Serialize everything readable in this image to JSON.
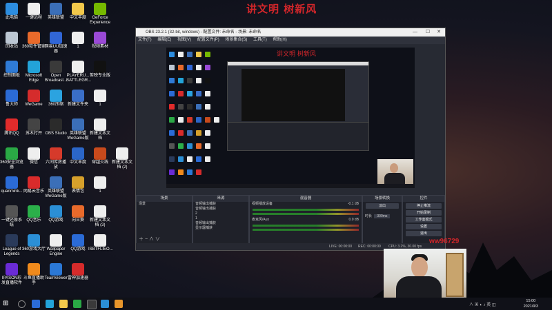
{
  "desktop": {
    "banner": "讲文明 树新风",
    "icons": [
      {
        "label": "此电脑",
        "col": 0,
        "row": 0,
        "color": "#2c8de0"
      },
      {
        "label": "一键远程",
        "col": 1,
        "row": 0,
        "color": "#eeeeee"
      },
      {
        "label": "英雄联盟",
        "col": 2,
        "row": 0,
        "color": "#3b6fb8"
      },
      {
        "label": "中文丰度",
        "col": 3,
        "row": 0,
        "color": "#f2c84b"
      },
      {
        "label": "GeForce Experience",
        "col": 4,
        "row": 0,
        "color": "#76b900"
      },
      {
        "label": "回收站",
        "col": 0,
        "row": 1,
        "color": "#bcc7d3"
      },
      {
        "label": "360软件管家",
        "col": 1,
        "row": 1,
        "color": "#e86a2b"
      },
      {
        "label": "网易UU加速器",
        "col": 2,
        "row": 1,
        "color": "#3166d6"
      },
      {
        "label": "1",
        "col": 3,
        "row": 1,
        "color": "#eeeeee"
      },
      {
        "label": "视频素材",
        "col": 4,
        "row": 1,
        "color": "#9a4ad6"
      },
      {
        "label": "控制面板",
        "col": 0,
        "row": 2,
        "color": "#2f7bd6"
      },
      {
        "label": "Microsoft Edge",
        "col": 1,
        "row": 2,
        "color": "#23a3d8"
      },
      {
        "label": "Open Broadcast...",
        "col": 2,
        "row": 2,
        "color": "#3a3a3a"
      },
      {
        "label": "PLAYERU... BATTLEGR...",
        "col": 3,
        "row": 2,
        "color": "#eeeeee"
      },
      {
        "label": "剪映专业版",
        "col": 4,
        "row": 2,
        "color": "#111111"
      },
      {
        "label": "鲁大师",
        "col": 0,
        "row": 3,
        "color": "#2b6bd6"
      },
      {
        "label": "WeGame",
        "col": 1,
        "row": 3,
        "color": "#d52c2c"
      },
      {
        "label": "360压缩",
        "col": 2,
        "row": 3,
        "color": "#2ba3e0"
      },
      {
        "label": "新建文件夹",
        "col": 3,
        "row": 3,
        "color": "#3a6ec8"
      },
      {
        "label": "1",
        "col": 4,
        "row": 3,
        "color": "#eeeeee"
      },
      {
        "label": "腾讯QQ",
        "col": 0,
        "row": 4,
        "color": "#e12b2b"
      },
      {
        "label": "苏木打开",
        "col": 1,
        "row": 4,
        "color": "#444444"
      },
      {
        "label": "OBS Studio",
        "col": 2,
        "row": 4,
        "color": "#2b2b2b"
      },
      {
        "label": "英雄联盟 WeGame版",
        "col": 3,
        "row": 4,
        "color": "#3b6fb8"
      },
      {
        "label": "新建文本文档",
        "col": 4,
        "row": 4,
        "color": "#eeeeee"
      },
      {
        "label": "360安全浏览器",
        "col": 0,
        "row": 5,
        "color": "#2aa845"
      },
      {
        "label": "微信",
        "col": 1,
        "row": 5,
        "color": "#eeeeee"
      },
      {
        "label": "六间库房播放",
        "col": 2,
        "row": 5,
        "color": "#d63a2b"
      },
      {
        "label": "中文丰度",
        "col": 3,
        "row": 5,
        "color": "#2b66c8"
      },
      {
        "label": "穿越火线",
        "col": 4,
        "row": 5,
        "color": "#c84a1c"
      },
      {
        "label": "新建文本文档 (2)",
        "col": 5,
        "row": 5,
        "color": "#eeeeee"
      },
      {
        "label": "quanmink...",
        "col": 0,
        "row": 6,
        "color": "#2b6bd6"
      },
      {
        "label": "网易云音乐",
        "col": 1,
        "row": 6,
        "color": "#d92b2b"
      },
      {
        "label": "英雄联盟 WeGame版",
        "col": 2,
        "row": 6,
        "color": "#3b6fb8"
      },
      {
        "label": "表情包",
        "col": 3,
        "row": 6,
        "color": "#d6a02b"
      },
      {
        "label": "1",
        "col": 4,
        "row": 6,
        "color": "#eeeeee"
      },
      {
        "label": "一键还原系统",
        "col": 0,
        "row": 7,
        "color": "#555555"
      },
      {
        "label": "QQ音乐",
        "col": 1,
        "row": 7,
        "color": "#2bb04a"
      },
      {
        "label": "QQ游戏",
        "col": 2,
        "row": 7,
        "color": "#2b8fd6"
      },
      {
        "label": "向日葵",
        "col": 3,
        "row": 7,
        "color": "#e86a2b"
      },
      {
        "label": "新建文本文档 (3)",
        "col": 4,
        "row": 7,
        "color": "#eeeeee"
      },
      {
        "label": "League of Legends",
        "col": 0,
        "row": 8,
        "color": "#2a3a5a"
      },
      {
        "label": "360游戏大厅",
        "col": 1,
        "row": 8,
        "color": "#2b8fd6"
      },
      {
        "label": "Wallpaper Engine",
        "col": 2,
        "row": 8,
        "color": "#eeeeee"
      },
      {
        "label": "QQ游戏",
        "col": 3,
        "row": 8,
        "color": "#2b6bd6"
      },
      {
        "label": "ISBTFLIEO...",
        "col": 4,
        "row": 8,
        "color": "#eeeeee"
      },
      {
        "label": "IPASON彩发直播软件",
        "col": 0,
        "row": 9,
        "color": "#6a2bd6"
      },
      {
        "label": "斗鱼直播助手",
        "col": 1,
        "row": 9,
        "color": "#f08a1c"
      },
      {
        "label": "TeamViewer",
        "col": 2,
        "row": 9,
        "color": "#2b78d6"
      },
      {
        "label": "雷神加速器",
        "col": 3,
        "row": 9,
        "color": "#d62b2b"
      }
    ]
  },
  "obs": {
    "title": "OBS 23.2.1 (32-bit, windows) - 配置文件: 未命名 - 场景: 未命名",
    "menu": [
      "文件(F)",
      "编辑(E)",
      "视图(V)",
      "配置文件(P)",
      "场景集合(S)",
      "工具(T)",
      "帮助(H)"
    ],
    "preview_banner": "讲文明 树新风",
    "panels": {
      "scenes": {
        "header": "场景",
        "items": [
          "场景"
        ]
      },
      "sources": {
        "header": "来源",
        "items": [
          "音频输出捕获",
          "音频输出捕获",
          "2",
          "1",
          "音频输出捕获",
          "显示器捕获"
        ]
      },
      "mixer": {
        "header": "混音器",
        "channels": [
          {
            "name": "视频播放设备",
            "db": "-0.1 dB"
          },
          {
            "name": "麦克风/Aux",
            "db": "0.0 dB"
          }
        ]
      },
      "transitions": {
        "header": "场景转换",
        "type": "淡出",
        "duration_label": "时长",
        "duration": "300ms"
      },
      "controls": {
        "header": "控件",
        "buttons": [
          "停止推流",
          "开始录制",
          "工作室模式",
          "设置",
          "退出"
        ]
      }
    },
    "status": {
      "live": "LIVE: 00:00:00",
      "rec": "REC: 00:00:00",
      "cpu": "CPU: 3.2%, 30.00 fps"
    }
  },
  "overlay": {
    "phone_left": "",
    "phone_right": "ww96729"
  },
  "taskbar": {
    "time": "15:00",
    "date": "2021/9/3"
  }
}
